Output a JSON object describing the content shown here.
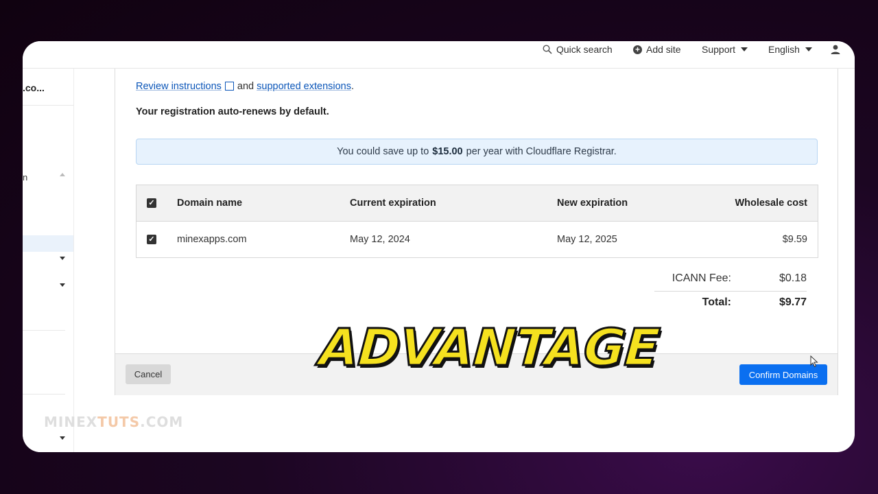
{
  "topnav": {
    "quick_search": "Quick search",
    "add_site": "Add site",
    "support": "Support",
    "language": "English"
  },
  "sidebar": {
    "account": ".co...",
    "item_fragment": "n"
  },
  "links": {
    "review": "Review instructions",
    "and": "and",
    "supported": "supported extensions",
    "period": "."
  },
  "autorenew_note": "Your registration auto-renews by default.",
  "banner": {
    "prefix": "You could save up to",
    "amount": "$15.00",
    "suffix": "per year with Cloudflare Registrar."
  },
  "table": {
    "headers": {
      "domain": "Domain name",
      "current": "Current expiration",
      "new": "New expiration",
      "cost": "Wholesale cost"
    },
    "rows": [
      {
        "domain": "minexapps.com",
        "current": "May 12, 2024",
        "new": "May 12, 2025",
        "cost": "$9.59",
        "checked": true
      }
    ]
  },
  "fees": {
    "icann_label": "ICANN Fee:",
    "icann_value": "$0.18",
    "total_label": "Total:",
    "total_value": "$9.77"
  },
  "footer": {
    "cancel": "Cancel",
    "confirm": "Confirm Domains"
  },
  "watermark": {
    "part1": "MINEX",
    "part2": "TUTS",
    "part3": ".COM"
  },
  "overlay_text": "ADVANTAGE",
  "colors": {
    "primary_button": "#0a6ff0",
    "link": "#0a55b8",
    "banner_bg": "#e7f2fd",
    "overlay_fill": "#f5e11f"
  }
}
